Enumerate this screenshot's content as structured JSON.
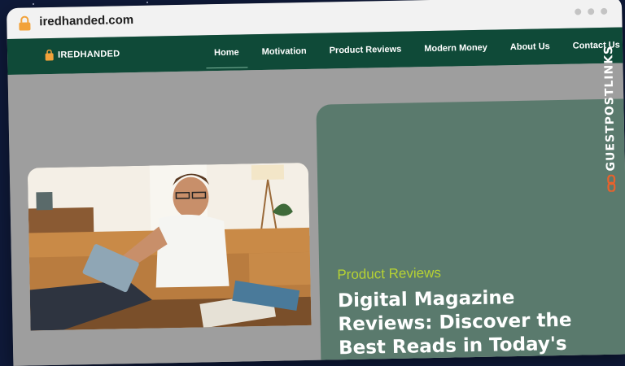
{
  "browser": {
    "url": "iredhanded.com"
  },
  "site": {
    "brand": "IREDHANDED",
    "nav": [
      {
        "label": "Home",
        "active": true
      },
      {
        "label": "Motivation",
        "active": false
      },
      {
        "label": "Product Reviews",
        "active": false
      },
      {
        "label": "Modern Money",
        "active": false
      },
      {
        "label": "About Us",
        "active": false
      },
      {
        "label": "Contact Us",
        "active": false
      }
    ]
  },
  "hero": {
    "category": "Product Reviews",
    "headline": "Digital Magazine Reviews: Discover the Best Reads in Today's Online World"
  },
  "watermark": {
    "text": "GUESTPOSTLINKS"
  },
  "colors": {
    "nav_bg": "#0f4a38",
    "panel_bg": "#5a7a6d",
    "category": "#b6d233",
    "page_bg": "#9e9e9e",
    "watermark_accent": "#e8622c"
  }
}
